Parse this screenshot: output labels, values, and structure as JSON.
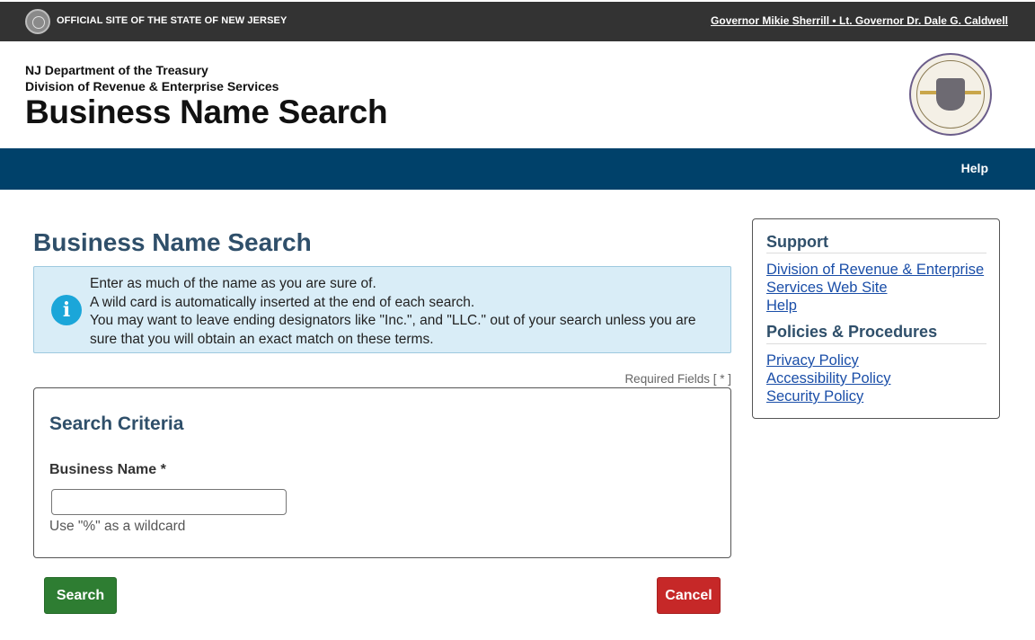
{
  "topbar": {
    "official_text": "OFFICIAL SITE OF THE STATE OF NEW JERSEY",
    "governor_text": "Governor Mikie Sherrill • Lt. Governor Dr. Dale G. Caldwell"
  },
  "header": {
    "dept_line1": "NJ Department of the Treasury",
    "dept_line2": "Division of Revenue & Enterprise Services",
    "title": "Business Name Search"
  },
  "nav": {
    "help_label": "Help"
  },
  "main": {
    "page_title": "Business Name Search",
    "info_lines": [
      "Enter as much of the name as you are sure of.",
      "A wild card is automatically inserted at the end of each search.",
      "You may want to leave ending designators like \"Inc.\", and \"LLC.\" out of your search unless you are sure that you will obtain an exact match on these terms."
    ],
    "required_text": "Required Fields [ * ]",
    "criteria": {
      "heading": "Search Criteria",
      "business_name_label": "Business Name *",
      "business_name_value": "",
      "hint": "Use \"%\" as a wildcard"
    },
    "search_button": "Search",
    "cancel_button": "Cancel"
  },
  "sidebar": {
    "support_heading": "Support",
    "support_links": [
      "Division of Revenue & Enterprise Services Web Site",
      "Help"
    ],
    "policies_heading": "Policies & Procedures",
    "policy_links": [
      "Privacy Policy",
      "Accessibility Policy",
      "Security Policy"
    ]
  },
  "colors": {
    "topbar": "#333333",
    "navbar": "#00416a",
    "heading": "#2f4f6a",
    "info_bg": "#d9edf7",
    "search_button": "#2e7d32",
    "cancel_button": "#c62828",
    "link": "#1a4ea8"
  },
  "icons": {
    "state_seal": "nj-state-seal-icon",
    "treasury_seal": "treasury-seal-icon",
    "info": "info-icon"
  }
}
